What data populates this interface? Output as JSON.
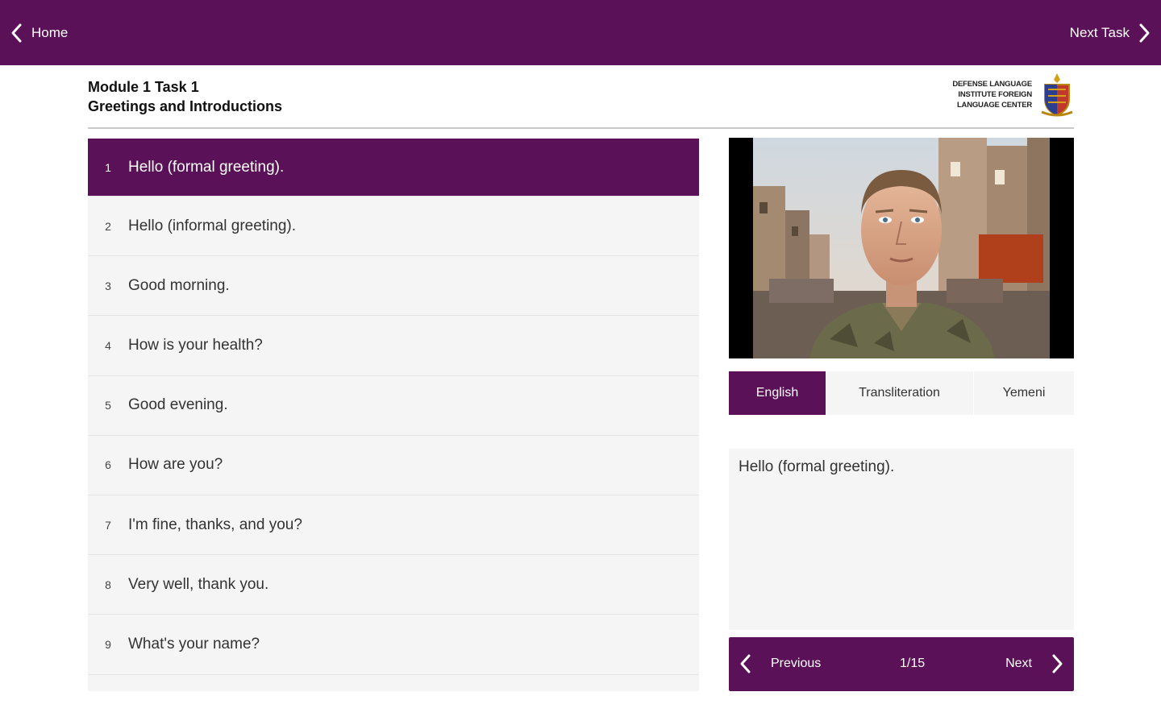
{
  "topbar": {
    "home_label": "Home",
    "next_task_label": "Next Task",
    "bg_color": "#5b1157"
  },
  "header": {
    "module_title": "Module 1 Task 1",
    "module_subtitle": "Greetings and Introductions",
    "logo_lines": [
      "DEFENSE LANGUAGE",
      "INSTITUTE FOREIGN",
      "LANGUAGE CENTER"
    ]
  },
  "phrases": [
    {
      "num": "1",
      "text": "Hello (formal greeting)."
    },
    {
      "num": "2",
      "text": "Hello (informal greeting)."
    },
    {
      "num": "3",
      "text": "Good morning."
    },
    {
      "num": "4",
      "text": "How is your health?"
    },
    {
      "num": "5",
      "text": "Good evening."
    },
    {
      "num": "6",
      "text": "How are you?"
    },
    {
      "num": "7",
      "text": "I'm fine, thanks, and you?"
    },
    {
      "num": "8",
      "text": "Very well, thank you."
    },
    {
      "num": "9",
      "text": "What's your name?"
    }
  ],
  "tabs": {
    "english": "English",
    "transliteration": "Transliteration",
    "yemeni": "Yemeni",
    "active": "English"
  },
  "translation": {
    "text": "Hello (formal greeting)."
  },
  "pager": {
    "previous_label": "Previous",
    "next_label": "Next",
    "count": "1/15"
  }
}
